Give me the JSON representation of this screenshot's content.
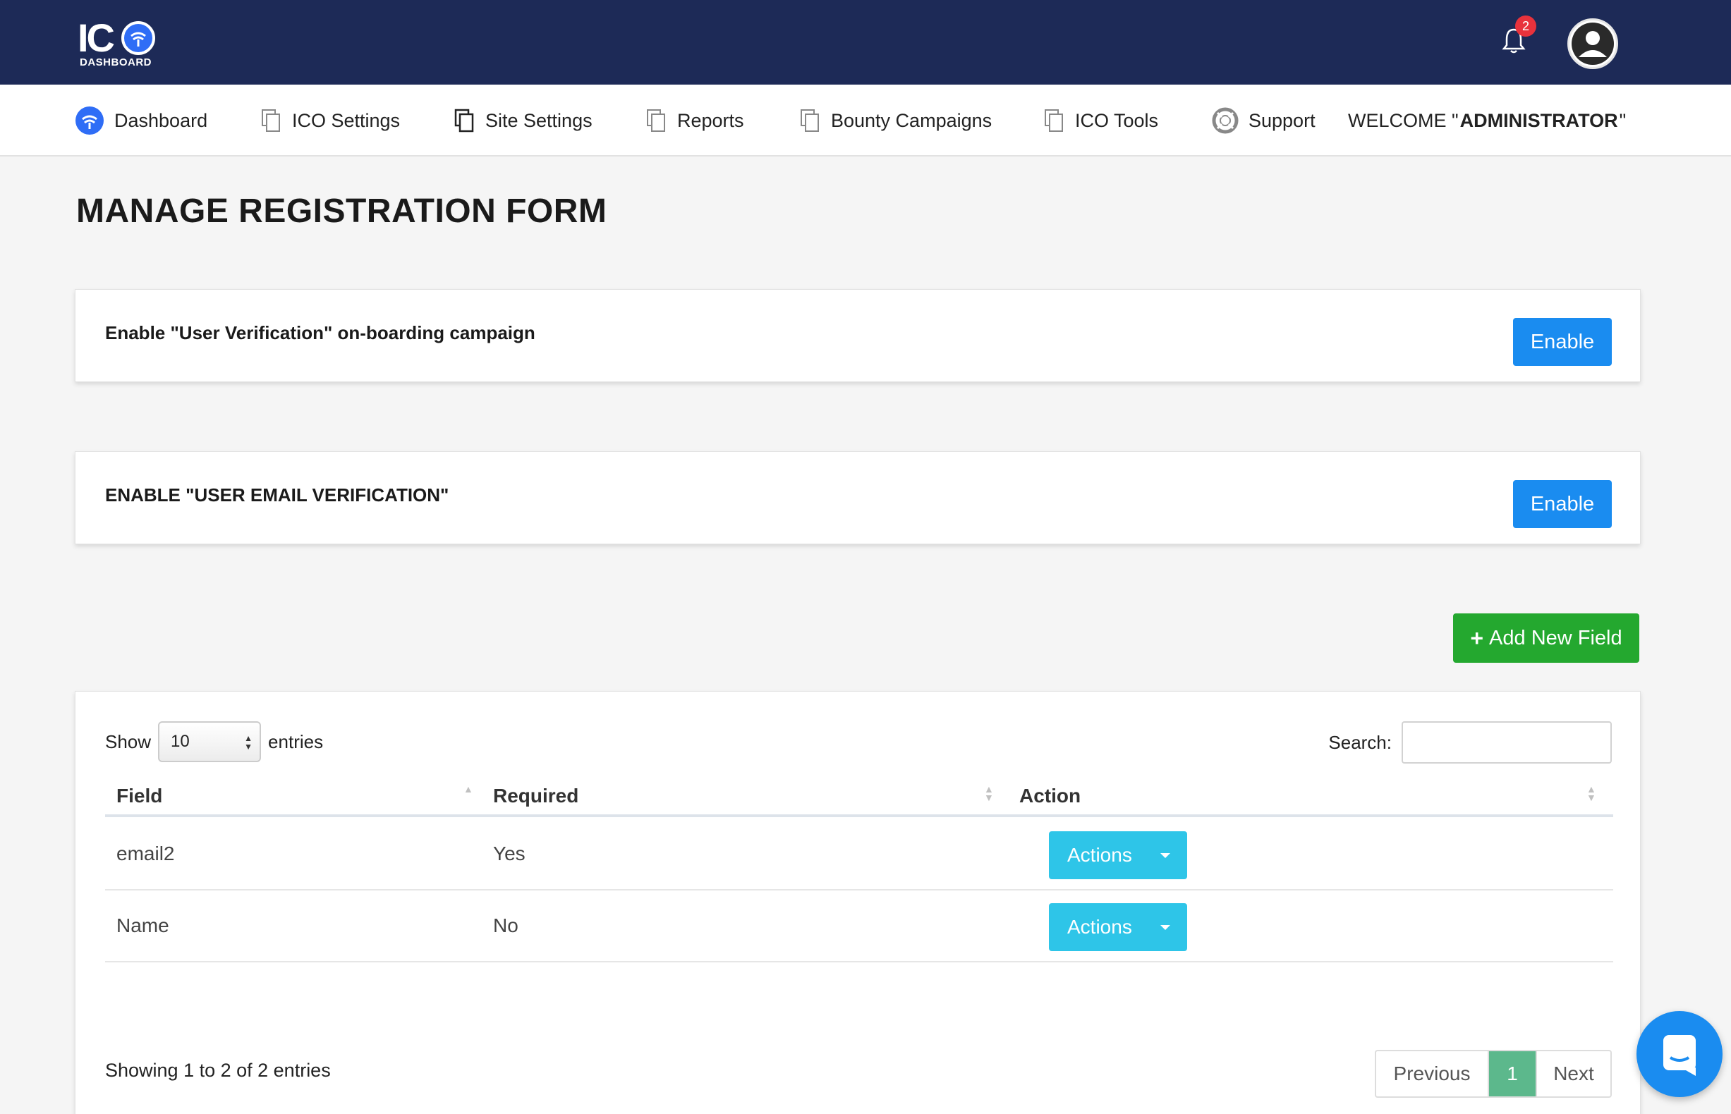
{
  "brand": {
    "logo_text": "IC",
    "logo_sub": "DASHBOARD"
  },
  "header": {
    "notification_count": "2"
  },
  "nav": {
    "items": [
      {
        "label": "Dashboard",
        "icon": "wifi-circle-icon"
      },
      {
        "label": "ICO Settings",
        "icon": "copy-icon"
      },
      {
        "label": "Site Settings",
        "icon": "copy-icon"
      },
      {
        "label": "Reports",
        "icon": "copy-icon"
      },
      {
        "label": "Bounty Campaigns",
        "icon": "copy-icon"
      },
      {
        "label": "ICO Tools",
        "icon": "copy-icon"
      },
      {
        "label": "Support",
        "icon": "lifebuoy-icon"
      }
    ],
    "welcome_prefix": "WELCOME \"",
    "welcome_user": "ADMINISTRATOR",
    "welcome_suffix": " \""
  },
  "page": {
    "title": "MANAGE REGISTRATION FORM"
  },
  "cards": {
    "user_verification": {
      "text": "Enable \"User Verification\" on-boarding campaign",
      "button": "Enable"
    },
    "email_verification": {
      "text": "ENABLE \"USER EMAIL VERIFICATION\"",
      "button": "Enable"
    }
  },
  "add_field": {
    "label": "Add New Field"
  },
  "table": {
    "show_label": "Show",
    "entries_label": "entries",
    "page_size": "10",
    "search_label": "Search:",
    "columns": [
      "Field",
      "Required",
      "Action"
    ],
    "rows": [
      {
        "field": "email2",
        "required": "Yes",
        "action": "Actions"
      },
      {
        "field": "Name",
        "required": "No",
        "action": "Actions"
      }
    ],
    "info": "Showing 1 to 2 of 2 entries",
    "pagination": {
      "previous": "Previous",
      "current": "1",
      "next": "Next"
    }
  },
  "colors": {
    "topbar": "#1d2a57",
    "primary": "#1a8cf0",
    "success": "#24a82f",
    "info": "#2ec5e8",
    "pager_active": "#5cb88c",
    "badge": "#e8323c"
  }
}
